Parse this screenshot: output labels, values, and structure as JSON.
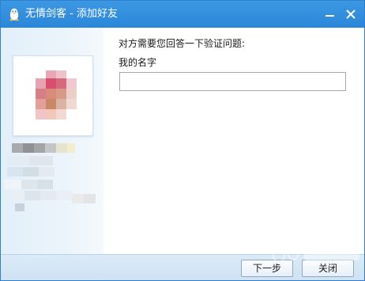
{
  "window": {
    "title": "无情剑客 - 添加好友",
    "app_icon": "penguin-icon",
    "minimize_icon": "minimize-icon",
    "close_icon": "close-icon",
    "title_bar_color": "#2a86d8"
  },
  "verification": {
    "prompt": "对方需要您回答一下验证问题:",
    "question": "我的名字",
    "answer_value": ""
  },
  "footer": {
    "next_label": "下一步",
    "close_label": "关闭"
  }
}
